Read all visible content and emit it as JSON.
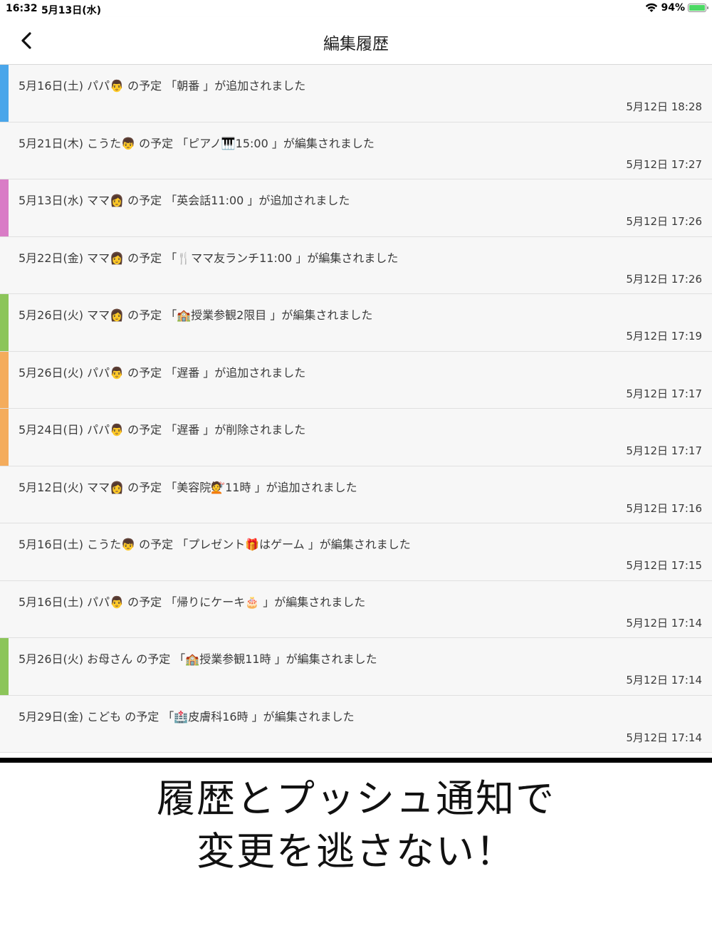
{
  "status": {
    "time": "16:32",
    "date": "5月13日(水)",
    "battery": "94%"
  },
  "nav": {
    "title": "編集履歴"
  },
  "history": [
    {
      "text": "5月16日(土) パパ👨 の予定 「朝番 」が追加されました",
      "time": "5月12日 18:28",
      "color": "#4aa6ea"
    },
    {
      "text": "5月21日(木) こうた👦 の予定 「ピアノ🎹15:00 」が編集されました",
      "time": "5月12日 17:27",
      "color": ""
    },
    {
      "text": "5月13日(水) ママ👩 の予定 「英会話11:00 」が追加されました",
      "time": "5月12日 17:26",
      "color": "#d97cc6"
    },
    {
      "text": "5月22日(金) ママ👩 の予定 「🍴ママ友ランチ11:00 」が編集されました",
      "time": "5月12日 17:26",
      "color": ""
    },
    {
      "text": "5月26日(火) ママ👩 の予定 「🏫授業参観2限目 」が編集されました",
      "time": "5月12日 17:19",
      "color": "#8cc55a"
    },
    {
      "text": "5月26日(火) パパ👨 の予定 「遅番 」が追加されました",
      "time": "5月12日 17:17",
      "color": "#f4ac5c"
    },
    {
      "text": "5月24日(日) パパ👨 の予定 「遅番 」が削除されました",
      "time": "5月12日 17:17",
      "color": "#f4ac5c"
    },
    {
      "text": "5月12日(火) ママ👩 の予定 「美容院💇11時 」が追加されました",
      "time": "5月12日 17:16",
      "color": ""
    },
    {
      "text": "5月16日(土) こうた👦 の予定 「プレゼント🎁はゲーム 」が編集されました",
      "time": "5月12日 17:15",
      "color": ""
    },
    {
      "text": "5月16日(土) パパ👨 の予定 「帰りにケーキ🎂 」が編集されました",
      "time": "5月12日 17:14",
      "color": ""
    },
    {
      "text": "5月26日(火) お母さん の予定 「🏫授業参観11時 」が編集されました",
      "time": "5月12日 17:14",
      "color": "#8cc55a"
    },
    {
      "text": "5月29日(金) こども の予定 「🏥皮膚科16時 」が編集されました",
      "time": "5月12日 17:14",
      "color": ""
    }
  ],
  "caption": {
    "line1": "履歴とプッシュ通知で",
    "line2": "変更を逃さない！"
  }
}
